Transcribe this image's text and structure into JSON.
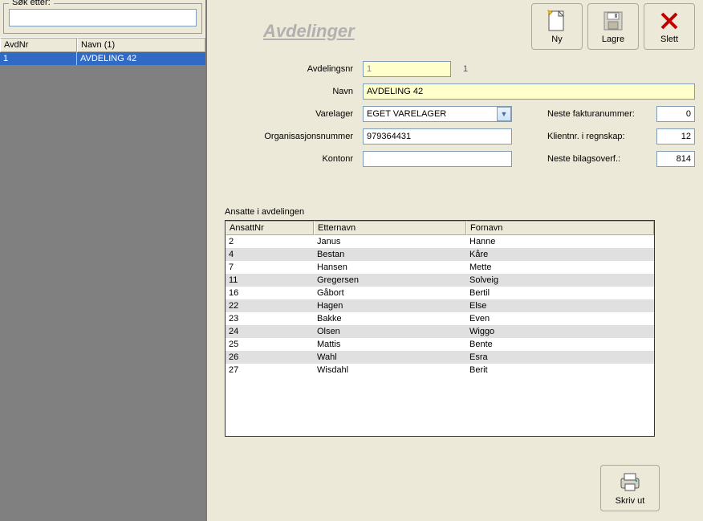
{
  "left": {
    "search_label": "Søk etter:",
    "search_value": "",
    "columns": {
      "avdnr": "AvdNr",
      "navn": "Navn (1)"
    },
    "rows": [
      {
        "avdnr": "1",
        "navn": "AVDELING 42"
      }
    ]
  },
  "title": "Avdelinger",
  "toolbar": {
    "ny": "Ny",
    "lagre": "Lagre",
    "slett": "Slett"
  },
  "form": {
    "avdelingsnr_label": "Avdelingsnr",
    "avdelingsnr_value": "1",
    "avdelingsnr_display": "1",
    "navn_label": "Navn",
    "navn_value": "AVDELING 42",
    "varelager_label": "Varelager",
    "varelager_value": "EGET VARELAGER",
    "orgnr_label": "Organisasjonsnummer",
    "orgnr_value": "979364431",
    "kontonr_label": "Kontonr",
    "kontonr_value": "",
    "neste_faktura_label": "Neste fakturanummer:",
    "neste_faktura_value": "0",
    "klientnr_label": "Klientnr. i regnskap:",
    "klientnr_value": "12",
    "neste_bilag_label": "Neste bilagsoverf.:",
    "neste_bilag_value": "814"
  },
  "ansatte": {
    "title": "Ansatte i avdelingen",
    "columns": {
      "nr": "AnsattNr",
      "etternavn": "Etternavn",
      "fornavn": "Fornavn"
    },
    "rows": [
      {
        "nr": "2",
        "etternavn": "Janus",
        "fornavn": "Hanne"
      },
      {
        "nr": "4",
        "etternavn": "Bestan",
        "fornavn": "Kåre"
      },
      {
        "nr": "7",
        "etternavn": "Hansen",
        "fornavn": "Mette"
      },
      {
        "nr": "11",
        "etternavn": "Gregersen",
        "fornavn": "Solveig"
      },
      {
        "nr": "16",
        "etternavn": "Gåbort",
        "fornavn": "Bertil"
      },
      {
        "nr": "22",
        "etternavn": "Hagen",
        "fornavn": "Else"
      },
      {
        "nr": "23",
        "etternavn": "Bakke",
        "fornavn": "Even"
      },
      {
        "nr": "24",
        "etternavn": "Olsen",
        "fornavn": "Wiggo"
      },
      {
        "nr": "25",
        "etternavn": "Mattis",
        "fornavn": "Bente"
      },
      {
        "nr": "26",
        "etternavn": "Wahl",
        "fornavn": "Esra"
      },
      {
        "nr": "27",
        "etternavn": "Wisdahl",
        "fornavn": "Berit"
      }
    ]
  },
  "print": {
    "label": "Skriv ut"
  }
}
